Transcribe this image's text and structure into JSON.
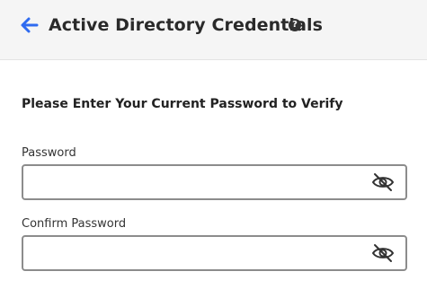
{
  "header": {
    "back_icon": "arrow-left-icon",
    "title": "Active Directory Credentials",
    "help_icon": "question-circle-icon",
    "help_glyph": "?",
    "accent_color": "#2f6bf0"
  },
  "form": {
    "heading": "Please Enter Your Current Password to Verify",
    "fields": [
      {
        "label": "Password",
        "value": "",
        "placeholder": "",
        "toggle_icon": "eye-slash-icon"
      },
      {
        "label": "Confirm Password",
        "value": "",
        "placeholder": "",
        "toggle_icon": "eye-slash-icon"
      }
    ]
  }
}
